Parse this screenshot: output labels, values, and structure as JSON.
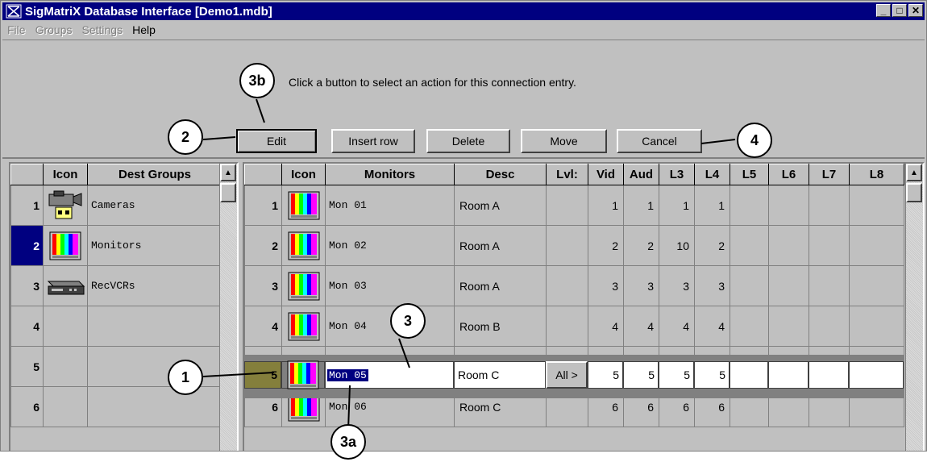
{
  "window": {
    "title": "SigMatriX Database Interface [Demo1.mdb]",
    "controls": [
      "_",
      "□",
      "✕"
    ]
  },
  "menu": {
    "items": [
      {
        "label": "File",
        "disabled": true
      },
      {
        "label": "Groups",
        "disabled": true
      },
      {
        "label": "Settings",
        "disabled": true
      },
      {
        "label": "Help",
        "disabled": false
      }
    ]
  },
  "toolbar": {
    "instruction": "Click a button to select an action for this connection entry.",
    "buttons": [
      "Edit",
      "Insert row",
      "Delete",
      "Move",
      "Cancel"
    ]
  },
  "groups_grid": {
    "headers": [
      "Icon",
      "Dest Groups"
    ],
    "rows": [
      {
        "num": "1",
        "icon": "camera-icon",
        "name": "Cameras"
      },
      {
        "num": "2",
        "icon": "monitor-icon",
        "name": "Monitors"
      },
      {
        "num": "3",
        "icon": "vcr-icon",
        "name": "RecVCRs"
      },
      {
        "num": "4",
        "icon": "",
        "name": ""
      },
      {
        "num": "5",
        "icon": "",
        "name": ""
      },
      {
        "num": "6",
        "icon": "",
        "name": ""
      }
    ]
  },
  "monitors_grid": {
    "headers": [
      "Icon",
      "Monitors",
      "Desc",
      "Lvl:",
      "Vid",
      "Aud",
      "L3",
      "L4",
      "L5",
      "L6",
      "L7",
      "L8"
    ],
    "rows": [
      {
        "num": "1",
        "name": "Mon 01",
        "desc": "Room A",
        "vid": "1",
        "aud": "1",
        "l3": "1",
        "l4": "1"
      },
      {
        "num": "2",
        "name": "Mon 02",
        "desc": "Room A",
        "vid": "2",
        "aud": "2",
        "l3": "10",
        "l4": "2"
      },
      {
        "num": "3",
        "name": "Mon 03",
        "desc": "Room A",
        "vid": "3",
        "aud": "3",
        "l3": "3",
        "l4": "3"
      },
      {
        "num": "4",
        "name": "Mon 04",
        "desc": "Room B",
        "vid": "4",
        "aud": "4",
        "l3": "4",
        "l4": "4"
      },
      {
        "num": "5",
        "name": "Mon 05",
        "desc": "Room C",
        "vid": "5",
        "aud": "5",
        "l3": "5",
        "l4": "5"
      },
      {
        "num": "6",
        "name": "Mon 06",
        "desc": "Room C",
        "vid": "6",
        "aud": "6",
        "l3": "6",
        "l4": "6"
      }
    ],
    "all_button": "All >"
  },
  "callouts": [
    "1",
    "2",
    "3",
    "3a",
    "3b",
    "4"
  ],
  "colors": {
    "titlebar": "#000080",
    "rownum": "#847f3c",
    "face": "#c0c0c0"
  }
}
